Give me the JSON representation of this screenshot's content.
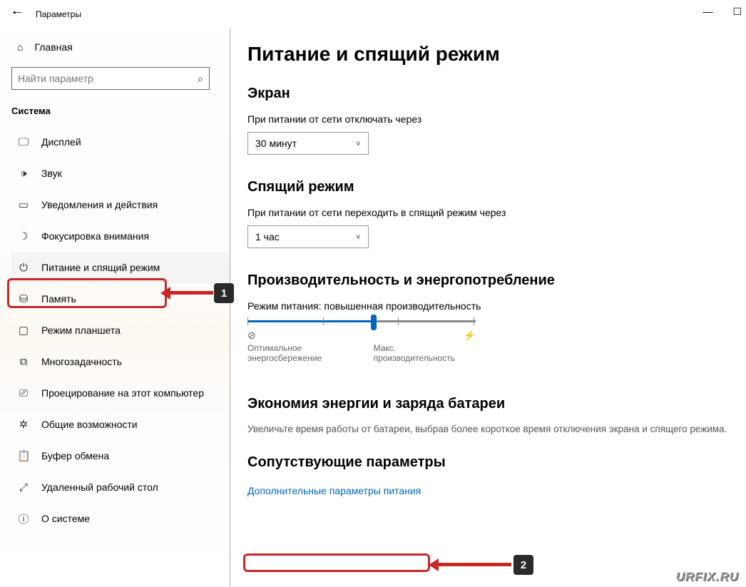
{
  "window": {
    "title": "Параметры"
  },
  "sidebar": {
    "home": "Главная",
    "search_placeholder": "Найти параметр",
    "category": "Система",
    "items": [
      {
        "label": "Дисплей"
      },
      {
        "label": "Звук"
      },
      {
        "label": "Уведомления и действия"
      },
      {
        "label": "Фокусировка внимания"
      },
      {
        "label": "Питание и спящий режим"
      },
      {
        "label": "Память"
      },
      {
        "label": "Режим планшета"
      },
      {
        "label": "Многозадачность"
      },
      {
        "label": "Проецирование на этот компьютер"
      },
      {
        "label": "Общие возможности"
      },
      {
        "label": "Буфер обмена"
      },
      {
        "label": "Удаленный рабочий стол"
      },
      {
        "label": "О системе"
      }
    ]
  },
  "main": {
    "title": "Питание и спящий режим",
    "screen_heading": "Экран",
    "screen_label": "При питании от сети отключать через",
    "screen_value": "30 минут",
    "sleep_heading": "Спящий режим",
    "sleep_label": "При питании от сети переходить в спящий режим через",
    "sleep_value": "1 час",
    "perf_heading": "Производительность и энергопотребление",
    "perf_mode": "Режим питания: повышенная производительность",
    "perf_min": "Оптимальное энергосбережение",
    "perf_max": "Макс. производительность",
    "battery_heading": "Экономия энергии и заряда батареи",
    "battery_desc": "Увеличьте время работы от батареи, выбрав более короткое время отключения экрана и спящего режима.",
    "related_heading": "Сопутствующие параметры",
    "related_link": "Дополнительные параметры питания"
  },
  "annotations": {
    "step1": "1",
    "step2": "2"
  },
  "watermark": "URFIX.RU"
}
